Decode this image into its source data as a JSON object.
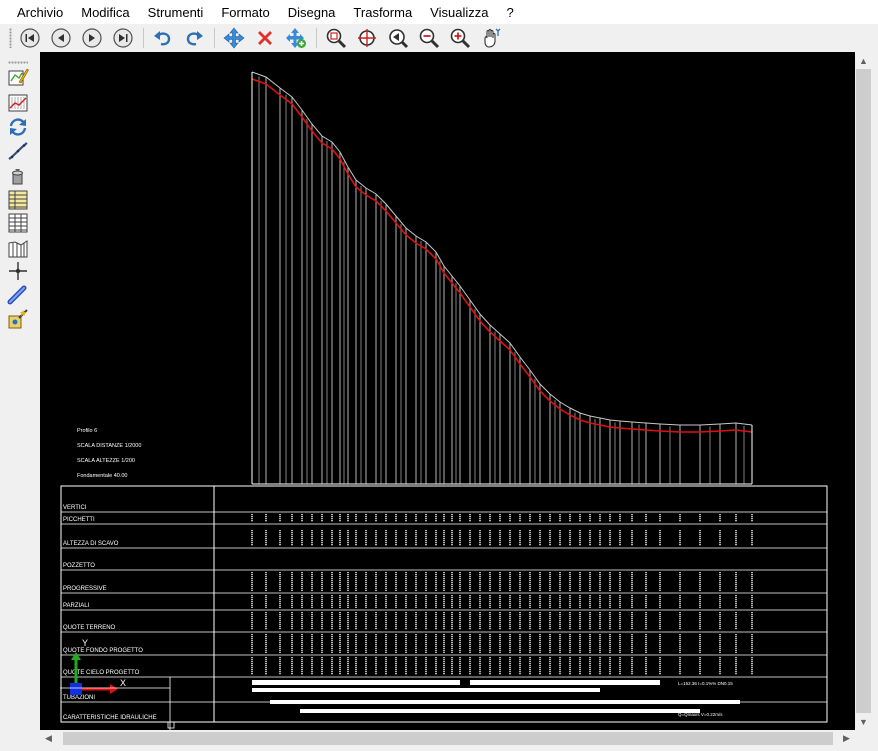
{
  "menu": [
    "Archivio",
    "Modifica",
    "Strumenti",
    "Formato",
    "Disegna",
    "Trasforma",
    "Visualizza",
    "?"
  ],
  "toolbar": {
    "nav": [
      "first-page-icon",
      "previous-page-icon",
      "next-page-icon",
      "last-page-icon"
    ],
    "edit": [
      "undo-icon",
      "redo-icon"
    ],
    "objects": [
      "move-icon",
      "delete-icon",
      "add-move-icon"
    ],
    "zoom": [
      "zoom-extents-icon",
      "zoom-window-icon",
      "zoom-previous-icon",
      "zoom-out-icon",
      "zoom-in-icon",
      "pan-icon"
    ]
  },
  "left_tools": [
    "edit-profile-icon",
    "profile-chart-icon",
    "refresh-icon",
    "pipe-slope-icon",
    "manhole-icon",
    "table-icon",
    "grid-table-icon",
    "section-icon",
    "crosshair-icon",
    "pipe-icon",
    "settings-wand-icon"
  ],
  "profile": {
    "info": [
      "Profilo 6",
      "SCALA DISTANZE 1/2000",
      "SCALA ALTEZZE 1/200",
      "Fondamentale 40.00"
    ],
    "rows": [
      "VERTICI",
      "PICCHETTI",
      "ALTEZZA DI SCAVO",
      "POZZETTO",
      "PROGRESSIVE",
      "PARZIALI",
      "QUOTE TERRENO",
      "QUOTE FONDO PROGETTO",
      "QUOTE CIELO PROGETTO",
      "TUBAZIONI",
      "CARATTERISTICHE IDRAULICHE"
    ],
    "pipe_labels": [
      "L=152.36 I=0.1%% DN0.15",
      "Q=Qmax/s V=0.22m/s"
    ],
    "axis_labels": [
      "Y",
      "X"
    ]
  },
  "colors": {
    "canvas": "#000000",
    "terrain_line": "#c8c8c8",
    "design_line": "#e01010",
    "ucs_y": "#22aa22",
    "ucs_x": "#e01010",
    "ucs_origin": "#1030e0"
  }
}
